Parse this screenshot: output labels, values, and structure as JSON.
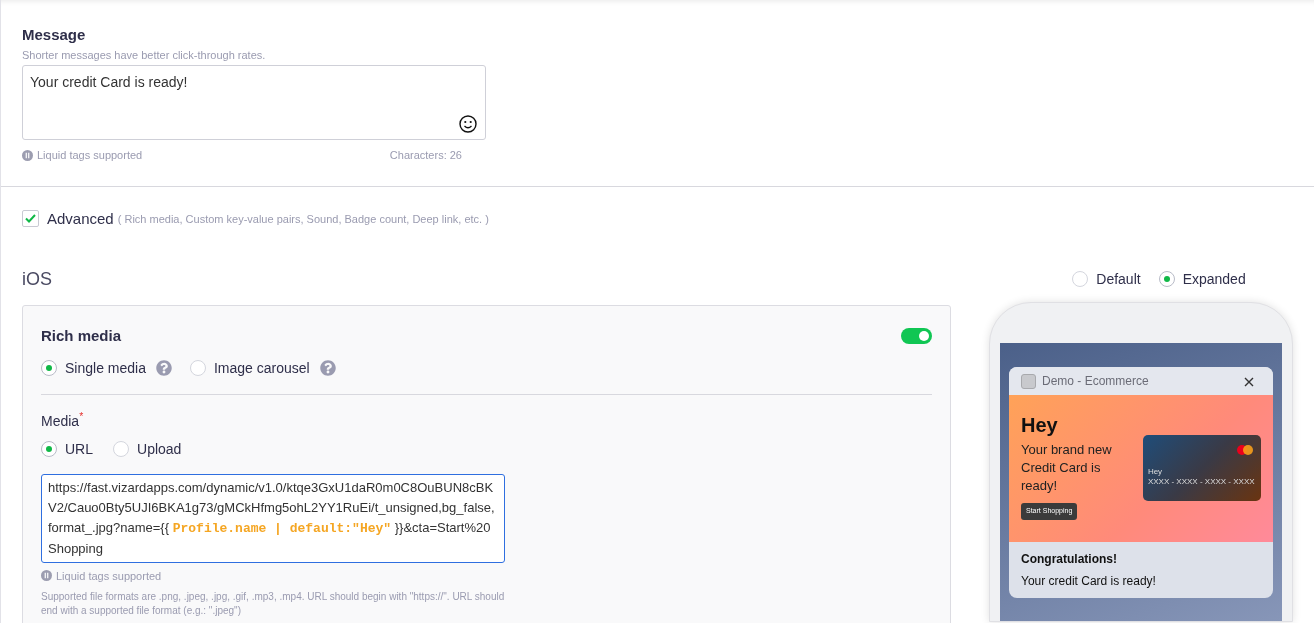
{
  "message": {
    "label": "Message",
    "hint": "Shorter messages have better click-through rates.",
    "value": "Your credit Card is ready!",
    "liquid_note": "Liquid tags supported",
    "char_count": "Characters: 26"
  },
  "advanced": {
    "label": "Advanced",
    "note": "( Rich media, Custom key-value pairs, Sound, Badge count, Deep link, etc. )",
    "checked": true
  },
  "platform": {
    "title": "iOS"
  },
  "rich_media": {
    "title": "Rich media",
    "on": true,
    "media_types": [
      {
        "label": "Single media",
        "selected": true
      },
      {
        "label": "Image carousel",
        "selected": false
      }
    ],
    "media_label": "Media",
    "required_mark": "*",
    "sources": [
      {
        "label": "URL",
        "selected": true
      },
      {
        "label": "Upload",
        "selected": false
      }
    ],
    "url_parts": [
      {
        "kind": "text",
        "text": "https://fast.vizardapps.com/dynamic/v1.0/ktqe3GxU1daR0m0C8OuBUN8cBKV2/Cauo0Bty5UJI6BKA1g73/gMCkHfmg5ohL2YY1RuEi/t_unsigned,bg_false,format_.jpg?name={{ "
      },
      {
        "kind": "tag",
        "text": "Profile.name | default:\"Hey\""
      },
      {
        "kind": "text",
        "text": " }}&cta=Start%20Shopping"
      }
    ],
    "liquid_note": "Liquid tags supported",
    "formats_note": "Supported file formats are .png, .jpeg, .jpg, .gif, .mp3, .mp4. URL should begin with \"https://\". URL should end with a supported file format (e.g.: \".jpeg\")"
  },
  "preview": {
    "modes": [
      {
        "label": "Default",
        "selected": false
      },
      {
        "label": "Expanded",
        "selected": true
      }
    ],
    "app_name": "Demo - Ecommerce",
    "banner": {
      "heading": "Hey",
      "text": "Your brand new Credit Card is ready!",
      "button": "Start Shopping",
      "card_name": "Hey",
      "card_number": "XXXX - XXXX - XXXX - XXXX"
    },
    "title": "Congratulations!",
    "body": "Your credit Card is ready!"
  }
}
